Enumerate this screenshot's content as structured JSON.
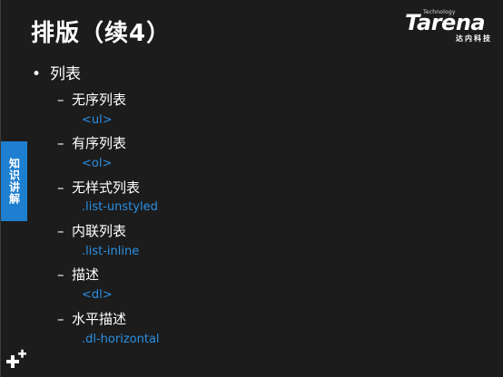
{
  "slide": {
    "title": "排版（续4）",
    "side_tab": "知识讲解",
    "logo": {
      "tech": "Technology",
      "word": "Tarena",
      "cn": "达内科技"
    },
    "bullet_char": "•",
    "dash_char": "–",
    "topic": "列表",
    "items": [
      {
        "label": "无序列表",
        "code": "<ul>"
      },
      {
        "label": "有序列表",
        "code": "<ol>"
      },
      {
        "label": "无样式列表",
        "code": ".list-unstyled"
      },
      {
        "label": "内联列表",
        "code": ".list-inline"
      },
      {
        "label": "描述",
        "code": "<dl>"
      },
      {
        "label": "水平描述",
        "code": ".dl-horizontal"
      }
    ]
  },
  "colors": {
    "background": "#1c1c1c",
    "text": "#ffffff",
    "code": "#2b8fe3",
    "side_tab": "#1e7fd0"
  },
  "icons": {
    "decor": "plus-sparkle-icon"
  }
}
